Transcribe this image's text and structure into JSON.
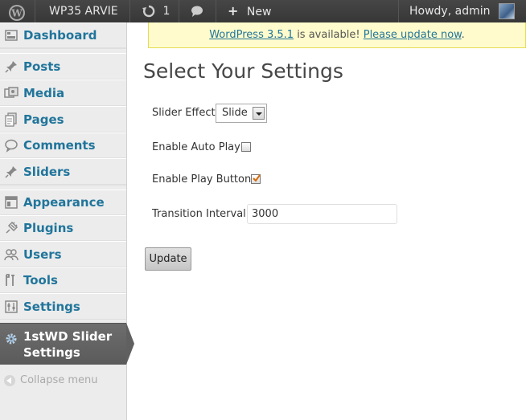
{
  "adminbar": {
    "wp_logo_icon": "wordpress-logo-icon",
    "site_name": "WP35 ARVIE",
    "updates_icon": "updates-refresh-icon",
    "updates_count": "1",
    "comments_icon": "comment-bubble-icon",
    "new_label": "New",
    "new_icon": "plus-icon",
    "howdy": "Howdy, admin",
    "avatar_icon": "user-avatar-icon"
  },
  "sidebar": {
    "items": [
      {
        "label": "Dashboard",
        "icon": "dashboard-icon"
      },
      {
        "label": "Posts",
        "icon": "pushpin-icon"
      },
      {
        "label": "Media",
        "icon": "media-icon"
      },
      {
        "label": "Pages",
        "icon": "pages-icon"
      },
      {
        "label": "Comments",
        "icon": "comments-icon"
      },
      {
        "label": "Sliders",
        "icon": "pushpin-icon"
      },
      {
        "label": "Appearance",
        "icon": "appearance-icon"
      },
      {
        "label": "Plugins",
        "icon": "plugins-icon"
      },
      {
        "label": "Users",
        "icon": "users-icon"
      },
      {
        "label": "Tools",
        "icon": "tools-icon"
      },
      {
        "label": "Settings",
        "icon": "settings-icon"
      }
    ],
    "current": {
      "label_line1": "1stWD Slider",
      "label_line2": "Settings",
      "icon": "gear-icon"
    },
    "collapse_label": "Collapse menu"
  },
  "nag": {
    "version_link": "WordPress 3.5.1",
    "middle_text": " is available! ",
    "update_link": "Please update now",
    "end_text": "."
  },
  "page": {
    "title": "Select Your Settings",
    "slider_effect_label": "Slider Effect",
    "slider_effect_value": "Slide",
    "auto_play_label": "Enable Auto Play",
    "auto_play_checked": false,
    "play_button_label": "Enable Play Button",
    "play_button_checked": true,
    "interval_label": "Transition Interval",
    "interval_value": "3000",
    "update_button": "Update"
  },
  "colors": {
    "adminbar_bg": "#464646",
    "sidebar_bg": "#ececec",
    "link": "#21759b",
    "current_bg": "#606060",
    "nag_bg": "#fffbcc"
  }
}
